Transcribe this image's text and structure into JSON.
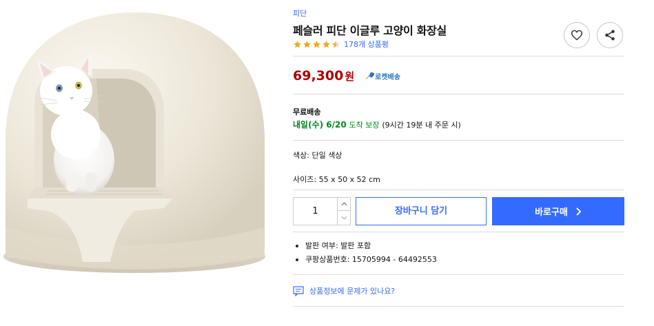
{
  "product": {
    "brand": "피단",
    "title": "페슬러 피단 이글루 고양이 화장실",
    "rating": 4.5,
    "review_count": "178개 상품평",
    "price_value": "69,300",
    "price_unit": "원",
    "rocket_label": "로켓배송"
  },
  "shipping": {
    "label": "무료배송",
    "date": "내일(수) 6/20",
    "guarantee": "도착 보장",
    "note": "(9시간 19분 내 주문 시)"
  },
  "options": {
    "color_label": "색상:",
    "color_value": "단일 색상",
    "size_label": "사이즈:",
    "size_value": "55 x 50 x 52 cm"
  },
  "purchase": {
    "quantity": "1",
    "cart_label": "장바구니 담기",
    "buy_label": "바로구매"
  },
  "details": [
    "발판 여부: 발판 포함",
    "쿠팡상품번호: 15705994 - 64492553"
  ],
  "report_label": "상품정보에 문제가 있나요?",
  "colors": {
    "accent": "#346aff",
    "price": "#ae0000",
    "rocket": "#00891a",
    "star": "#f2a71b"
  }
}
